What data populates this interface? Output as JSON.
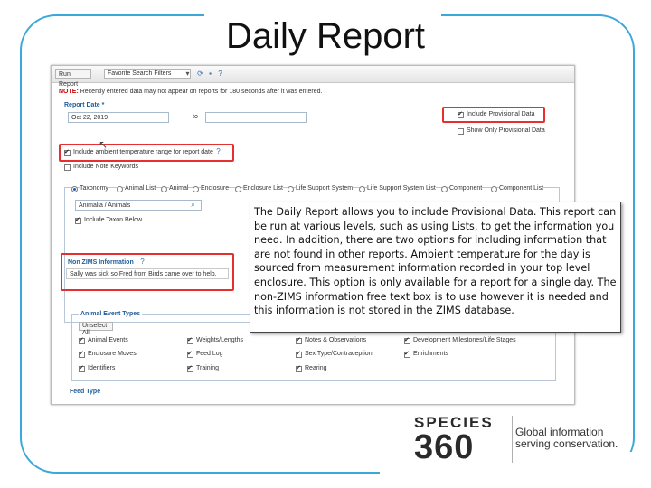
{
  "slide": {
    "title": "Daily Report"
  },
  "toolbar": {
    "run_report": "Run Report",
    "search_filters": "Favorite Search Filters"
  },
  "note": {
    "prefix": "NOTE:",
    "text": "Recently entered data may not appear on reports for 180 seconds after it was entered."
  },
  "report_date": {
    "label": "Report Date *",
    "from_value": "Oct 22, 2019",
    "to_label": "to"
  },
  "provisional": {
    "include_label": "Include Provisional Data",
    "show_only_label": "Show Only Provisional Data"
  },
  "options": {
    "ambient_label": "Include ambient temperature range for report date",
    "note_keywords_label": "Include Note Keywords"
  },
  "tabs": [
    {
      "label": "Taxonomy"
    },
    {
      "label": "Animal List"
    },
    {
      "label": "Animal"
    },
    {
      "label": "Enclosure"
    },
    {
      "label": "Enclosure List"
    },
    {
      "label": "Life Support System"
    },
    {
      "label": "Life Support System List"
    },
    {
      "label": "Component"
    },
    {
      "label": "Component List"
    }
  ],
  "taxonomy": {
    "value": "Animalia / Animals",
    "include_taxon_below": "Include Taxon Below"
  },
  "non_zims": {
    "heading": "Non ZIMS Information",
    "text": "Sally was sick so Fred from Birds came over to help."
  },
  "event_types": {
    "heading": "Animal Event Types",
    "unselect_all": "Unselect All",
    "col1": [
      "Animal Events",
      "Enclosure Moves",
      "Identifiers"
    ],
    "col2": [
      "Weights/Lengths",
      "Feed Log",
      "Training"
    ],
    "col3": [
      "Notes & Observations",
      "Sex Type/Contraception",
      "Rearing"
    ],
    "col4": [
      "Development Milestones/Life Stages",
      "Enrichments"
    ]
  },
  "feed_type": {
    "label": "Feed Type"
  },
  "callout": {
    "text": "The Daily Report allows you to include Provisional Data. This report can be run at various levels, such as using Lists, to get the information you need. In addition, there are two options for including information that are not found in other reports. Ambient temperature for the day is sourced from measurement information recorded in your top level enclosure. This option is only available for a report for a single day. The non-ZIMS information free text box is to use however it is needed and this information is not stored in the ZIMS database."
  },
  "logo": {
    "species": "SPECIES",
    "number": "360",
    "tagline_1": "Global information",
    "tagline_2": "serving conservation."
  },
  "colors": {
    "frame": "#3aa8d8",
    "highlight": "#e53030",
    "section": "#1f5d99"
  }
}
